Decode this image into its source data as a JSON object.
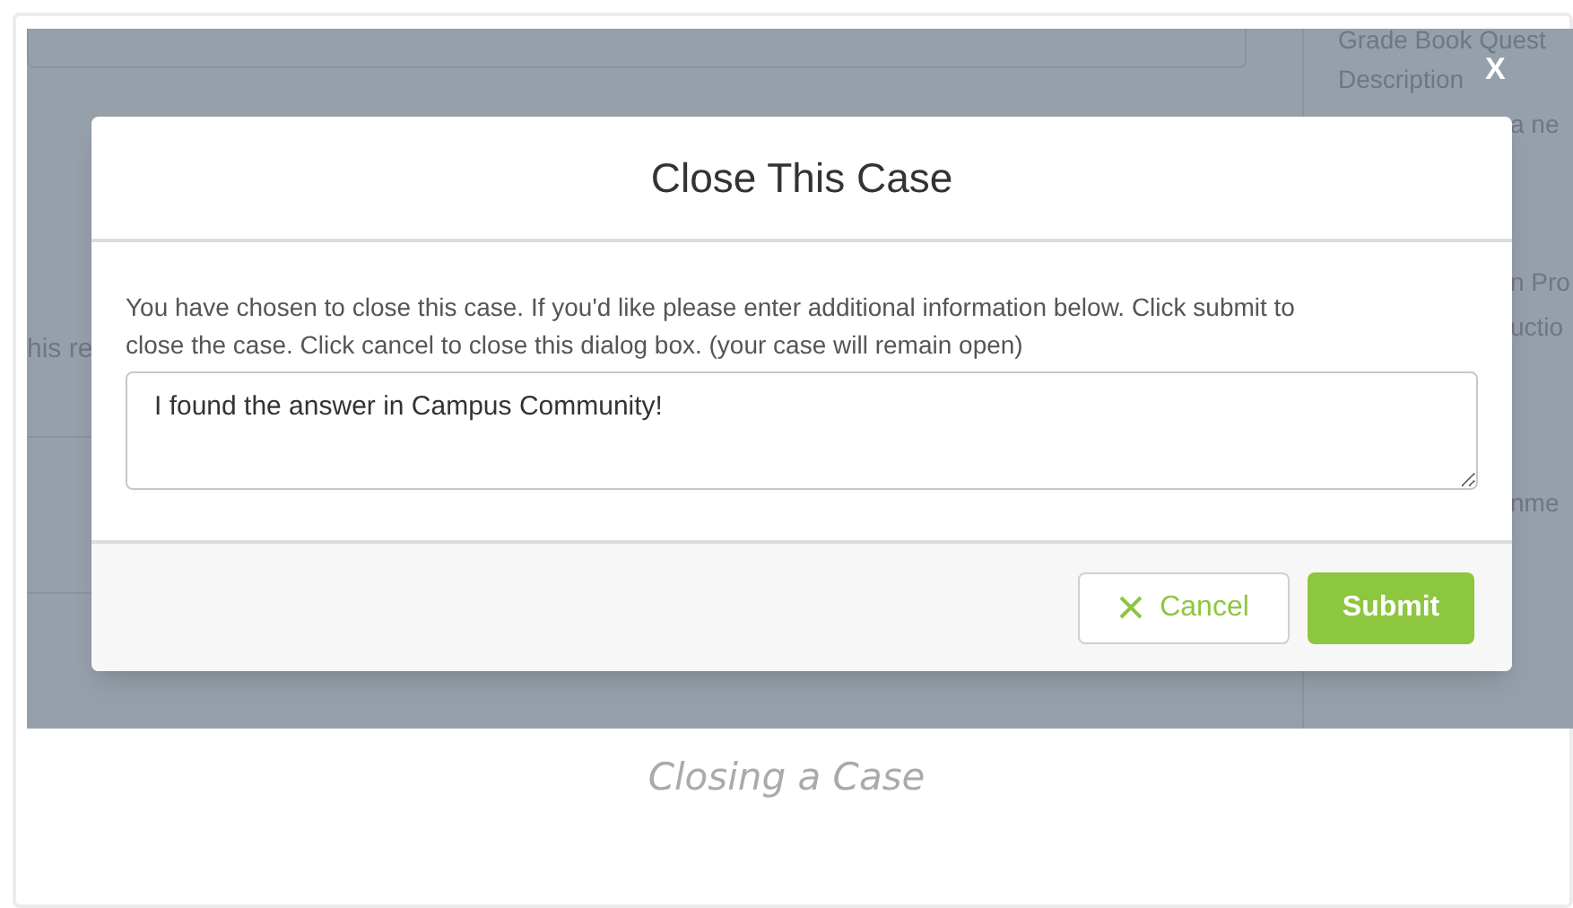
{
  "background": {
    "left_fragments": [
      "his re"
    ],
    "right_fragments": [
      "Grade Book Quest",
      "Description",
      "a ne",
      "n Pro",
      "uctio",
      "nme"
    ]
  },
  "dialog": {
    "close_label": "X",
    "title": "Close This Case",
    "message": "You have chosen to close this case. If you'd like please enter additional information below. Click submit to close the case. Click cancel to close this dialog box. (your case will remain open)",
    "comment": {
      "value": "I found the answer in Campus Community!"
    },
    "buttons": [
      {
        "kind": "cancel",
        "label": "Cancel"
      },
      {
        "kind": "submit",
        "label": "Submit"
      }
    ]
  },
  "caption": "Closing a Case"
}
